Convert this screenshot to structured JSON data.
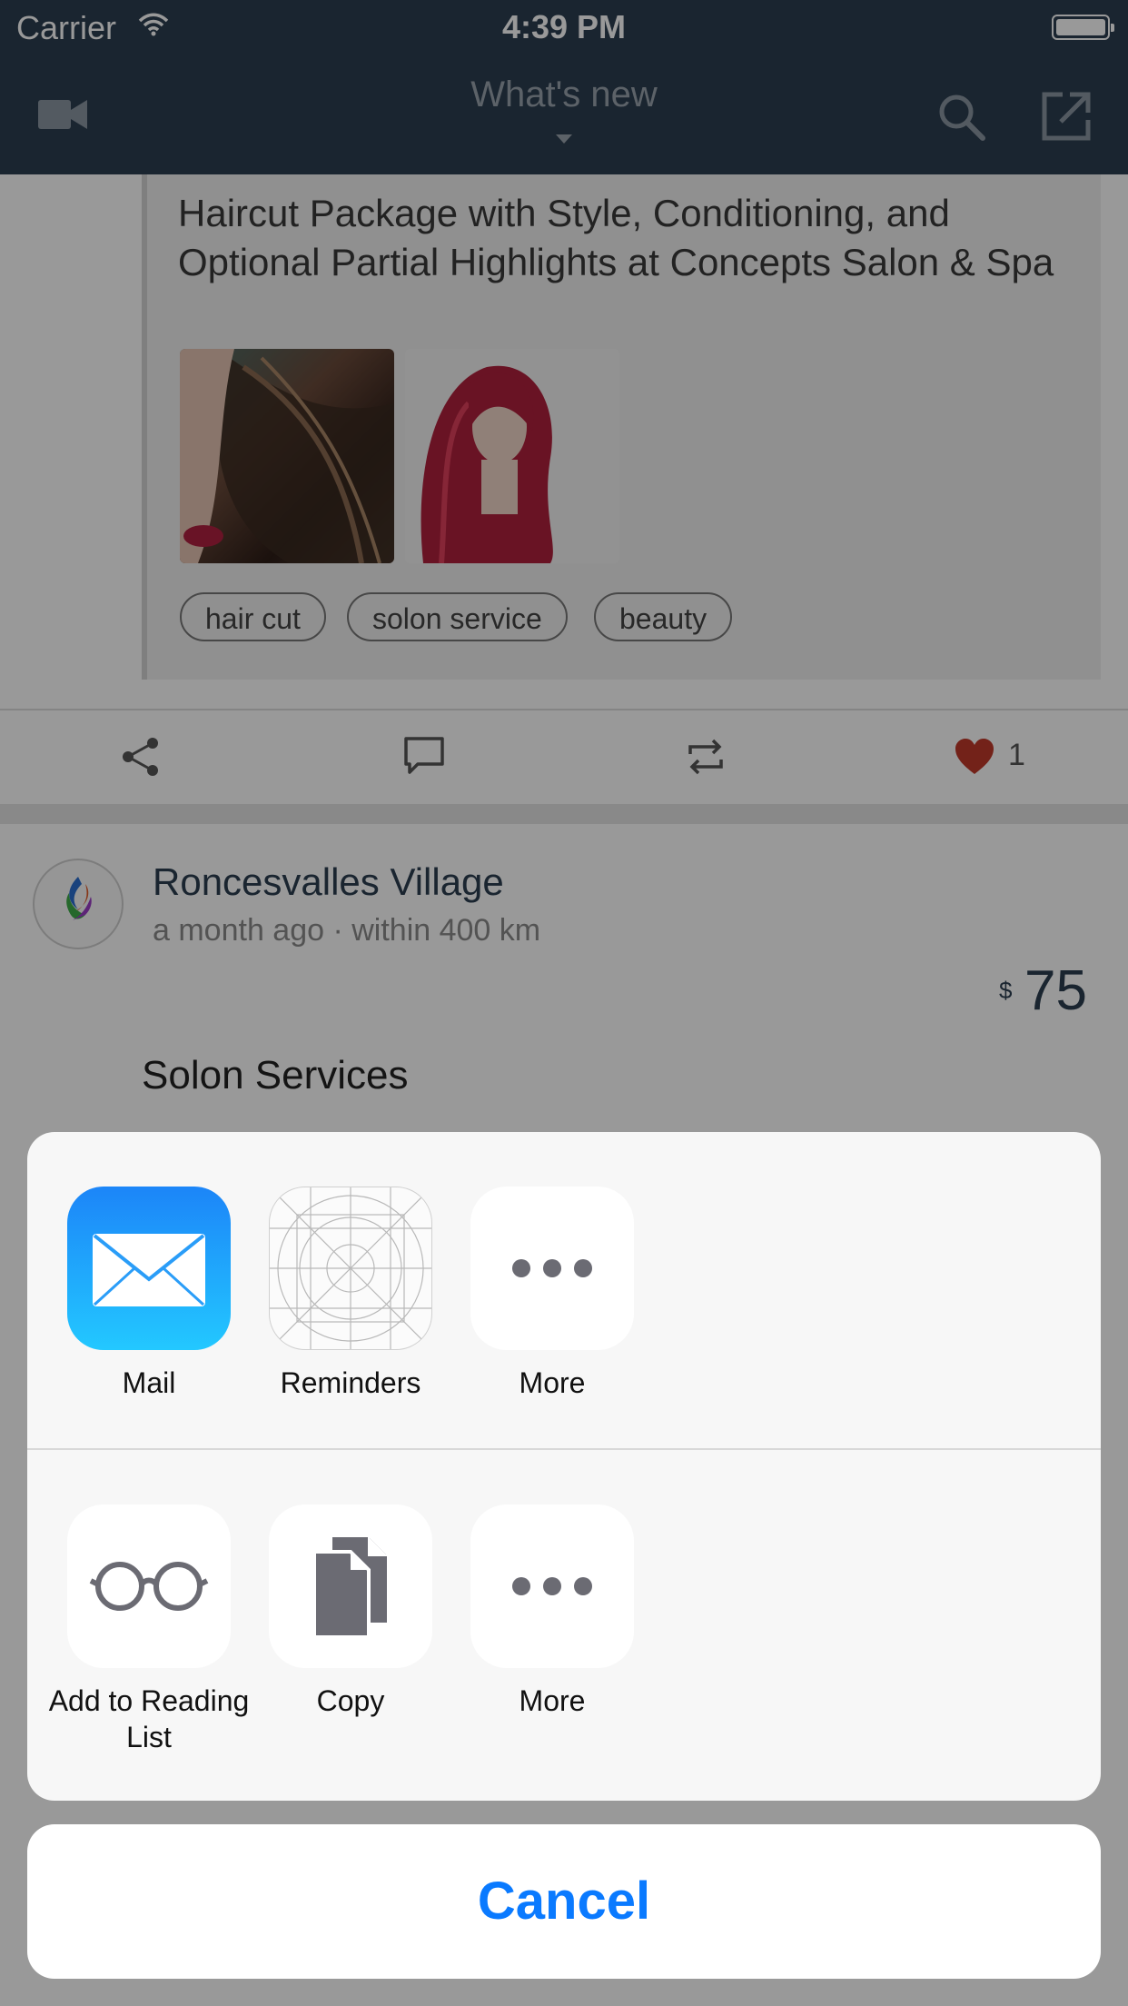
{
  "status_bar": {
    "carrier": "Carrier",
    "time": "4:39 PM"
  },
  "nav": {
    "title": "What's new"
  },
  "feed": {
    "deal": {
      "title": "Haircut Package with Style, Conditioning, and Optional Partial Highlights at Concepts Salon & Spa",
      "tags": [
        "hair cut",
        "solon service",
        "beauty"
      ],
      "likes": "1"
    },
    "post": {
      "author": "Roncesvalles Village",
      "meta": "a month ago · within 400 km",
      "currency": "$",
      "price": "75",
      "subject": "Solon Services"
    }
  },
  "share_sheet": {
    "apps": [
      {
        "label": "Mail",
        "icon": "mail-icon"
      },
      {
        "label": "Reminders",
        "icon": "reminders-icon"
      },
      {
        "label": "More",
        "icon": "more-icon"
      }
    ],
    "actions": [
      {
        "label": "Add to Reading List",
        "icon": "glasses-icon"
      },
      {
        "label": "Copy",
        "icon": "copy-icon"
      },
      {
        "label": "More",
        "icon": "more-icon"
      }
    ],
    "cancel_label": "Cancel"
  },
  "colors": {
    "nav_bg": "#2c3e50",
    "accent": "#0a7aff",
    "like": "#c0392b"
  }
}
